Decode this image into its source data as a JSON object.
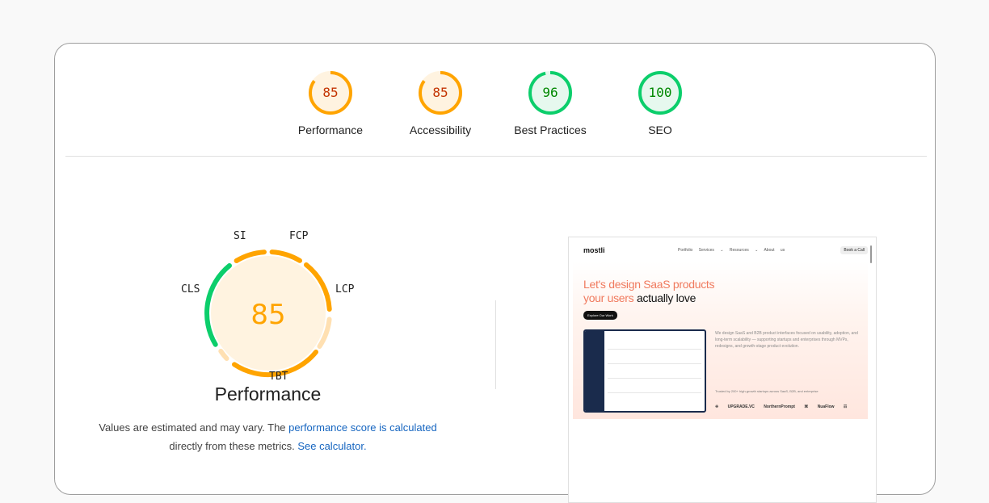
{
  "categories": [
    {
      "score": "85",
      "label": "Performance",
      "score_fraction": 0.85,
      "color": "#ffa400",
      "text_color": "#c33300",
      "fill": "#fff3e0"
    },
    {
      "score": "85",
      "label": "Accessibility",
      "score_fraction": 0.85,
      "color": "#ffa400",
      "text_color": "#c33300",
      "fill": "#fff3e0"
    },
    {
      "score": "96",
      "label": "Best Practices",
      "score_fraction": 0.96,
      "color": "#0cce6b",
      "text_color": "#008800",
      "fill": "#e6f8ee"
    },
    {
      "score": "100",
      "label": "SEO",
      "score_fraction": 1.0,
      "color": "#0cce6b",
      "text_color": "#008800",
      "fill": "#e6f8ee"
    }
  ],
  "performance": {
    "score": "85",
    "title": "Performance",
    "metrics": {
      "si": "SI",
      "fcp": "FCP",
      "lcp": "LCP",
      "tbt": "TBT",
      "cls": "CLS"
    },
    "note_prefix": "Values are estimated and may vary. The ",
    "note_link": "performance score is calculated",
    "note_middle": "directly from these metrics.",
    "note_link2": "See calculator."
  },
  "screenshot": {
    "logo": "mostli",
    "nav": "Portfolio Services ⌄ Resources ⌄ About us",
    "cta": "Book a Call",
    "headline_1": "Let's design SaaS products",
    "headline_2a": "your users ",
    "headline_2b": "actually love",
    "button": "Explore Our Work",
    "description": "We design SaaS and B2B product interfaces focused on usability, adoption, and long-term scalability — supporting startups and enterprises through MVPs, redesigns, and growth-stage product evolution.",
    "trusted": "Trusted by 200+ high-growth startups across SaaS, B2B, and enterprise",
    "logos": "⁜ UPGRADE.VC NorthernPrompt ⌘ NuaFlow ☶"
  }
}
